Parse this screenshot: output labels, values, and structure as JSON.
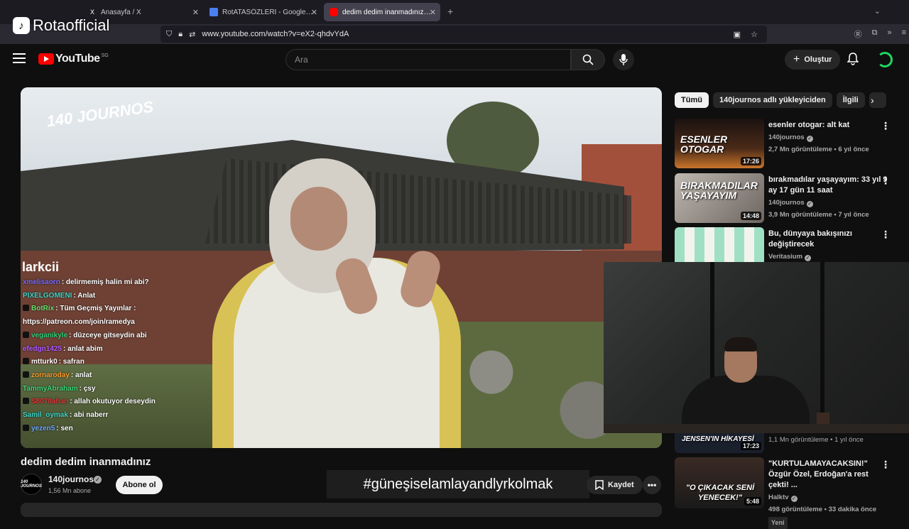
{
  "overlay": {
    "logo_name": "Rotaofficial",
    "hashtag": "#güneşiselamlayandlyrkolmak"
  },
  "browser": {
    "tabs": [
      {
        "label": "Anasayfa / X",
        "favicon": "X"
      },
      {
        "label": "RotATASÖZLERİ - Google Dokü",
        "favicon": "docs-icon"
      },
      {
        "label": "dedim dedim inanmadınız - You",
        "favicon": "youtube-icon"
      }
    ],
    "url": "www.youtube.com/watch?v=eX2-qhdvYdA"
  },
  "youtube": {
    "logo": "YouTube",
    "country": "SG",
    "search_placeholder": "Ara",
    "create_label": "Oluştur"
  },
  "video": {
    "watermark": "140 JOURNOS",
    "title": "dedim dedim inanmadınız",
    "channel": "140journos",
    "subscribers": "1,56 Mn abone",
    "subscribe_label": "Abone ol",
    "save_label": "Kaydet"
  },
  "chat": {
    "header": "larkcii",
    "messages": [
      {
        "user": "xmelisaorn",
        "text": ": delirmemiş halin mi abi?",
        "color": "#7b6cff"
      },
      {
        "user": "PIXELGOMENI",
        "text": ": Anlat",
        "color": "#3fd4c6"
      },
      {
        "user": "BotRix",
        "text": ": Tüm Geçmiş Yayınlar : https://patreon.com/join/ramedya",
        "color": "#6ee06e"
      },
      {
        "user": "veganikyle",
        "text": ": düzceye gitseydin abi",
        "color": "#2fd07a"
      },
      {
        "user": "efedgn1425",
        "text": ": anlat abim",
        "color": "#b15cff"
      },
      {
        "user": "mtturk0",
        "text": ": safran",
        "color": "#ffffff"
      },
      {
        "user": "zornaroday",
        "text": ": anlat",
        "color": "#ff9f2e"
      },
      {
        "user": "TammyAbraham",
        "text": ": çsy",
        "color": "#3fd47a"
      },
      {
        "user": "S8078ahan",
        "text": ": allah okutuyor deseydin",
        "color": "#e03a3a"
      },
      {
        "user": "Samil_oymak",
        "text": ": abi naberr",
        "color": "#3fd4c6"
      },
      {
        "user": "yezen5",
        "text": ": sen",
        "color": "#6fa8ff"
      }
    ]
  },
  "chips": [
    "Tümü",
    "140journos adlı yükleyiciden",
    "İlgili"
  ],
  "recommendations": [
    {
      "title": "esenler otogar: alt kat",
      "channel": "140journos",
      "meta": "2,7 Mn görüntüleme • 6 yıl önce",
      "duration": "17:26",
      "thumb_text": "ESENLER OTOGAR"
    },
    {
      "title": "bırakmadılar yaşayayım: 33 yıl 9 ay 17 gün 11 saat",
      "channel": "140journos",
      "meta": "3,9 Mn görüntüleme • 7 yıl önce",
      "duration": "14:48",
      "thumb_text": "BIRAKMADILAR YAŞAYAYIM"
    },
    {
      "title": "Bu, dünyaya bakışınızı değiştirecek",
      "channel": "Veritasium",
      "meta": "",
      "duration": "",
      "thumb_text": ""
    },
    {
      "title": "",
      "channel": "",
      "meta": "1,1 Mn görüntüleme • 1 yıl önce",
      "duration": "17:23",
      "thumb_text": "JENSEN'IN HİKAYESİ"
    },
    {
      "title": "\"KURTULAMAYACAKSIN!\" Özgür Özel, Erdoğan'a rest çekti! ...",
      "channel": "Halktv",
      "meta": "498 görüntüleme • 33 dakika önce",
      "duration": "5:48",
      "thumb_text": "\"O ÇIKACAK SENİ YENECEK!\"",
      "badge": "Yeni"
    }
  ],
  "colors": {
    "brand_red": "#ff0000",
    "background": "#0f0f0f"
  }
}
